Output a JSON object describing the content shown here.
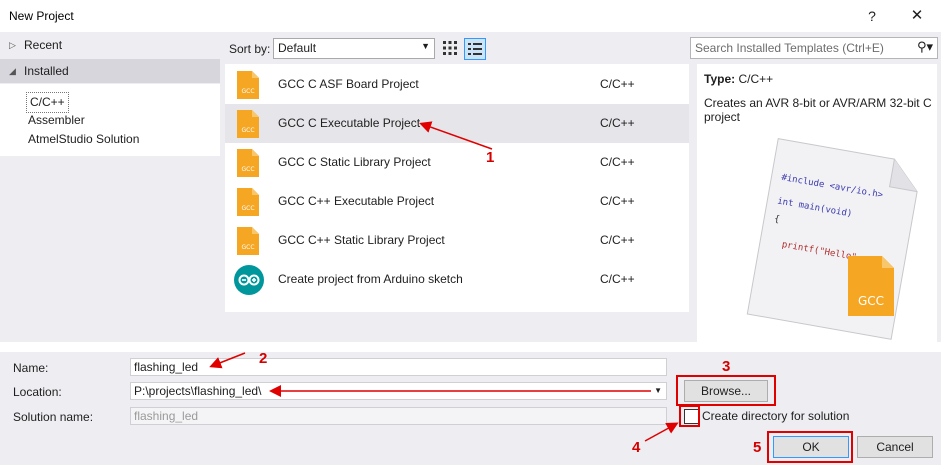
{
  "window": {
    "title": "New Project",
    "help": "?",
    "close": "✕"
  },
  "tree": {
    "recent": "Recent",
    "installed": "Installed",
    "children": [
      "C/C++",
      "Assembler",
      "AtmelStudio Solution"
    ]
  },
  "toolbar": {
    "sort_label": "Sort by:",
    "sort_value": "Default",
    "search_placeholder": "Search Installed Templates (Ctrl+E)"
  },
  "templates": [
    {
      "name": "GCC C ASF Board Project",
      "lang": "C/C++",
      "icon": "gcc-icon"
    },
    {
      "name": "GCC C Executable Project",
      "lang": "C/C++",
      "icon": "gcc-icon"
    },
    {
      "name": "GCC C Static Library Project",
      "lang": "C/C++",
      "icon": "gcc-icon"
    },
    {
      "name": "GCC C++ Executable Project",
      "lang": "C/C++",
      "icon": "gcc-icon"
    },
    {
      "name": "GCC C++ Static Library Project",
      "lang": "C/C++",
      "icon": "gcc-icon"
    },
    {
      "name": "Create project from Arduino sketch",
      "lang": "C/C++",
      "icon": "arduino-icon"
    }
  ],
  "details": {
    "type_label": "Type:",
    "type_value": "C/C++",
    "description": "Creates an AVR 8-bit or AVR/ARM 32-bit C project",
    "code_lines": [
      "#include <avr/io.h>",
      "int main(void)",
      "{",
      "printf(\"Hello\""
    ],
    "badge": "GCC"
  },
  "form": {
    "name_label": "Name:",
    "name_value": "flashing_led",
    "location_label": "Location:",
    "location_value": "P:\\projects\\flashing_led\\",
    "solution_label": "Solution name:",
    "solution_value": "flashing_led",
    "browse": "Browse...",
    "create_dir": "Create directory for solution",
    "ok": "OK",
    "cancel": "Cancel"
  },
  "annotations": [
    "1",
    "2",
    "3",
    "4",
    "5"
  ],
  "colors": {
    "accent": "#3399ff",
    "annotation": "#e00000",
    "gcc_orange": "#f5a623"
  }
}
